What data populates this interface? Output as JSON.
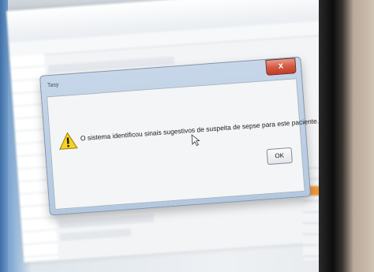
{
  "dialog": {
    "title": "Tasy",
    "close_label": "x",
    "message": "O sistema identificou sinais sugestivos de suspeita de sepse para este paciente.",
    "ok_label": "OK",
    "icon": "warning-icon"
  },
  "colors": {
    "warning_fill": "#f7d21e",
    "close_button": "#d45a44",
    "dialog_frame": "#b3c8df"
  }
}
